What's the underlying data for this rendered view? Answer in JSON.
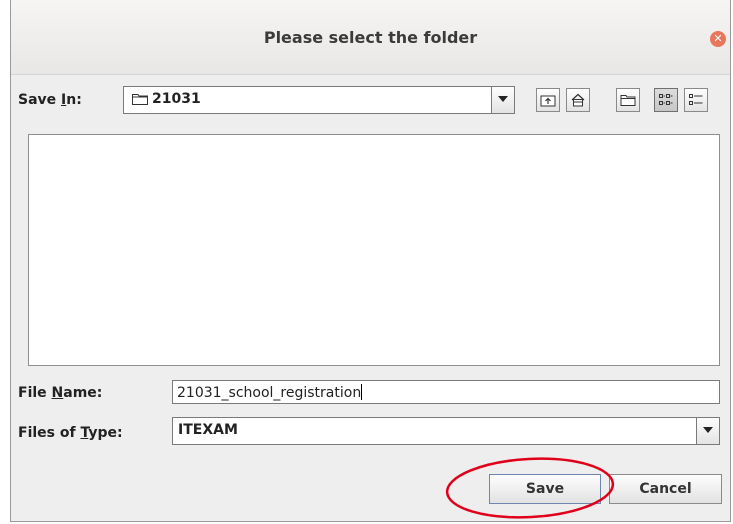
{
  "dialog": {
    "title": "Please select the folder",
    "close_icon": "close-icon",
    "close_color": "#e8765a"
  },
  "save_in": {
    "label_pre": "Save ",
    "label_mnemonic": "I",
    "label_post": "n:",
    "value": "21031",
    "icon": "folder-icon"
  },
  "toolbar": {
    "buttons": [
      {
        "name": "up-one-level-button",
        "icon": "folder-up-icon"
      },
      {
        "name": "home-button",
        "icon": "home-icon"
      },
      {
        "name": "new-folder-button",
        "icon": "new-folder-icon"
      },
      {
        "name": "list-view-button",
        "icon": "list-view-icon",
        "active": true
      },
      {
        "name": "details-view-button",
        "icon": "details-view-icon"
      }
    ]
  },
  "file_list": {
    "items": []
  },
  "file_name": {
    "label_pre": "File ",
    "label_mnemonic": "N",
    "label_post": "ame:",
    "value": "21031_school_registration"
  },
  "files_of_type": {
    "label_pre": "Files of ",
    "label_mnemonic": "T",
    "label_post": "ype:",
    "value": "ITEXAM"
  },
  "buttons": {
    "save_label": "Save",
    "cancel_label": "Cancel"
  },
  "annotation": {
    "shape": "ellipse",
    "color": "#e0001b"
  }
}
